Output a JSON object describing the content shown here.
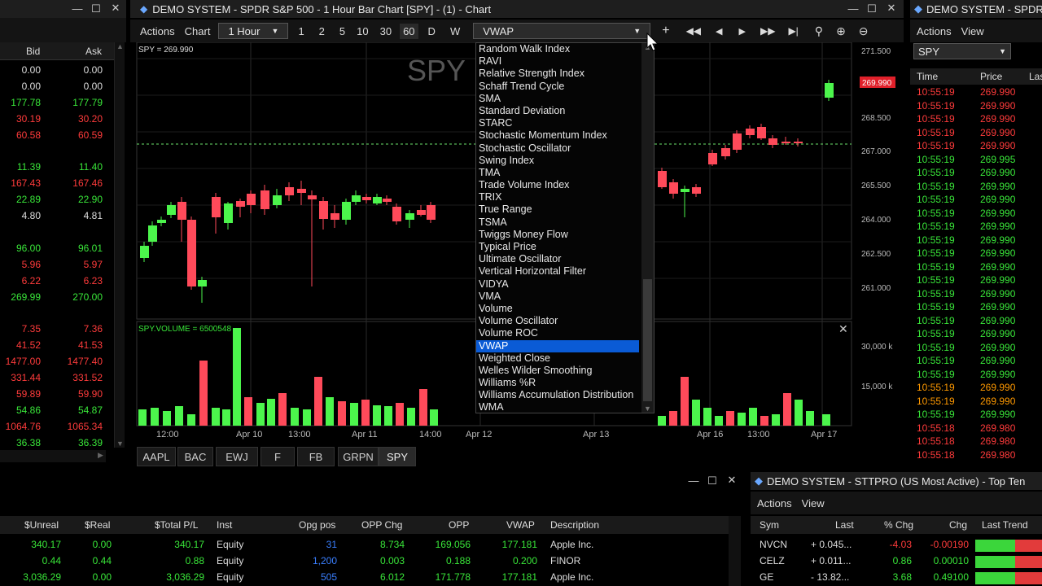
{
  "left_panel": {
    "col_bid": "Bid",
    "col_ask": "Ask",
    "rows": [
      {
        "bid": "0.00",
        "ask": "0.00",
        "c": "wht"
      },
      {
        "bid": "0.00",
        "ask": "0.00",
        "c": "wht"
      },
      {
        "bid": "177.78",
        "ask": "177.79",
        "c": "grn"
      },
      {
        "bid": "30.19",
        "ask": "30.20",
        "c": "red"
      },
      {
        "bid": "60.58",
        "ask": "60.59",
        "c": "red"
      },
      {
        "bid": "",
        "ask": "",
        "c": "wht"
      },
      {
        "bid": "11.39",
        "ask": "11.40",
        "c": "grn"
      },
      {
        "bid": "167.43",
        "ask": "167.46",
        "c": "red"
      },
      {
        "bid": "22.89",
        "ask": "22.90",
        "c": "grn"
      },
      {
        "bid": "4.80",
        "ask": "4.81",
        "c": "wht"
      },
      {
        "bid": "",
        "ask": "",
        "c": "wht"
      },
      {
        "bid": "96.00",
        "ask": "96.01",
        "c": "grn"
      },
      {
        "bid": "5.96",
        "ask": "5.97",
        "c": "red"
      },
      {
        "bid": "6.22",
        "ask": "6.23",
        "c": "red"
      },
      {
        "bid": "269.99",
        "ask": "270.00",
        "c": "grn"
      },
      {
        "bid": "",
        "ask": "",
        "c": "wht"
      },
      {
        "bid": "7.35",
        "ask": "7.36",
        "c": "red"
      },
      {
        "bid": "41.52",
        "ask": "41.53",
        "c": "red"
      },
      {
        "bid": "1477.00",
        "ask": "1477.40",
        "c": "red"
      },
      {
        "bid": "331.44",
        "ask": "331.52",
        "c": "red"
      },
      {
        "bid": "59.89",
        "ask": "59.90",
        "c": "red"
      },
      {
        "bid": "54.86",
        "ask": "54.87",
        "c": "grn"
      },
      {
        "bid": "1064.76",
        "ask": "1065.34",
        "c": "red"
      },
      {
        "bid": "36.38",
        "ask": "36.39",
        "c": "grn"
      }
    ]
  },
  "chart_window": {
    "title": "DEMO SYSTEM - SPDR S&P 500 - 1 Hour Bar Chart [SPY] - (1) - Chart",
    "menu_actions": "Actions",
    "menu_chart": "Chart",
    "interval_value": "1 Hour",
    "interval_buttons": [
      "1",
      "2",
      "5",
      "10",
      "30",
      "60",
      "D",
      "W"
    ],
    "indicator_value": "VWAP",
    "price_label": "SPY = 269.990",
    "watermark": "SPY",
    "volume_label": "SPY.VOLUME = 6500548",
    "price_ticks": [
      "271.500",
      "268.500",
      "267.000",
      "265.500",
      "264.000",
      "262.500",
      "261.000"
    ],
    "last_price_tag": "269.990",
    "volume_ticks": [
      "30,000 k",
      "15,000 k"
    ],
    "time_labels": [
      "12:00",
      "Apr 10",
      "13:00",
      "Apr 11",
      "14:00",
      "Apr 12",
      "Apr 13",
      "Apr 16",
      "13:00",
      "Apr 17"
    ],
    "tabs": [
      "AAPL",
      "BAC",
      "EWJ",
      "F",
      "FB",
      "GRPN",
      "SPY"
    ],
    "active_tab": "SPY"
  },
  "indicator_dropdown": {
    "items": [
      "Random Walk Index",
      "RAVI",
      "Relative Strength Index",
      "Schaff Trend Cycle",
      "SMA",
      "Standard Deviation",
      "STARC",
      "Stochastic Momentum Index",
      "Stochastic Oscillator",
      "Swing Index",
      "TMA",
      "Trade Volume Index",
      "TRIX",
      "True Range",
      "TSMA",
      "Twiggs Money Flow",
      "Typical Price",
      "Ultimate Oscillator",
      "Vertical Horizontal Filter",
      "VIDYA",
      "VMA",
      "Volume",
      "Volume Oscillator",
      "Volume ROC",
      "VWAP",
      "Weighted Close",
      "Welles Wilder Smoothing",
      "Williams %R",
      "Williams Accumulation Distribution",
      "WMA"
    ],
    "selected": "VWAP"
  },
  "timesales_window": {
    "title": "DEMO SYSTEM - SPDR",
    "menu_actions": "Actions",
    "menu_view": "View",
    "symbol": "SPY",
    "col_time": "Time",
    "col_price": "Price",
    "col_last": "Las",
    "rows": [
      {
        "t": "10:55:19",
        "p": "269.990",
        "c": "red"
      },
      {
        "t": "10:55:19",
        "p": "269.990",
        "c": "red"
      },
      {
        "t": "10:55:19",
        "p": "269.990",
        "c": "red"
      },
      {
        "t": "10:55:19",
        "p": "269.990",
        "c": "red"
      },
      {
        "t": "10:55:19",
        "p": "269.990",
        "c": "red"
      },
      {
        "t": "10:55:19",
        "p": "269.995",
        "c": "grn"
      },
      {
        "t": "10:55:19",
        "p": "269.990",
        "c": "grn"
      },
      {
        "t": "10:55:19",
        "p": "269.990",
        "c": "grn"
      },
      {
        "t": "10:55:19",
        "p": "269.990",
        "c": "grn"
      },
      {
        "t": "10:55:19",
        "p": "269.990",
        "c": "grn"
      },
      {
        "t": "10:55:19",
        "p": "269.990",
        "c": "grn"
      },
      {
        "t": "10:55:19",
        "p": "269.990",
        "c": "grn"
      },
      {
        "t": "10:55:19",
        "p": "269.990",
        "c": "grn"
      },
      {
        "t": "10:55:19",
        "p": "269.990",
        "c": "grn"
      },
      {
        "t": "10:55:19",
        "p": "269.990",
        "c": "grn"
      },
      {
        "t": "10:55:19",
        "p": "269.990",
        "c": "grn"
      },
      {
        "t": "10:55:19",
        "p": "269.990",
        "c": "grn"
      },
      {
        "t": "10:55:19",
        "p": "269.990",
        "c": "grn"
      },
      {
        "t": "10:55:19",
        "p": "269.990",
        "c": "grn"
      },
      {
        "t": "10:55:19",
        "p": "269.990",
        "c": "grn"
      },
      {
        "t": "10:55:19",
        "p": "269.990",
        "c": "grn"
      },
      {
        "t": "10:55:19",
        "p": "269.990",
        "c": "grn"
      },
      {
        "t": "10:55:19",
        "p": "269.990",
        "c": "org"
      },
      {
        "t": "10:55:19",
        "p": "269.990",
        "c": "org"
      },
      {
        "t": "10:55:19",
        "p": "269.990",
        "c": "grn"
      },
      {
        "t": "10:55:18",
        "p": "269.980",
        "c": "red"
      },
      {
        "t": "10:55:18",
        "p": "269.980",
        "c": "red"
      },
      {
        "t": "10:55:18",
        "p": "269.980",
        "c": "red"
      }
    ]
  },
  "positions_window": {
    "headers": [
      "$Unreal",
      "$Real",
      "$Total P/L",
      "Inst",
      "Opg pos",
      "OPP Chg",
      "OPP",
      "VWAP",
      "Description"
    ],
    "rows": [
      {
        "unreal": "340.17",
        "real": "0.00",
        "total": "340.17",
        "inst": "Equity",
        "opg": "31",
        "oppchg": "8.734",
        "opp": "169.056",
        "vwap": "177.181",
        "desc": "Apple Inc."
      },
      {
        "unreal": "0.44",
        "real": "0.44",
        "total": "0.88",
        "inst": "Equity",
        "opg": "1,200",
        "oppchg": "0.003",
        "opp": "0.188",
        "vwap": "0.200",
        "desc": "FINOR"
      },
      {
        "unreal": "3,036.29",
        "real": "0.00",
        "total": "3,036.29",
        "inst": "Equity",
        "opg": "505",
        "oppchg": "6.012",
        "opp": "171.778",
        "vwap": "177.181",
        "desc": "Apple Inc."
      }
    ]
  },
  "topten_window": {
    "title": "DEMO SYSTEM - STTPRO (US Most Active) - Top Ten",
    "menu_actions": "Actions",
    "menu_view": "View",
    "headers": [
      "Sym",
      "Last",
      "% Chg",
      "Chg",
      "Last Trend"
    ],
    "rows": [
      {
        "sym": "NVCN",
        "last": "+ 0.045...",
        "pct": "-4.03",
        "chg": "-0.00190",
        "c": "red"
      },
      {
        "sym": "CELZ",
        "last": "+ 0.011...",
        "pct": "0.86",
        "chg": "0.00010",
        "c": "grn"
      },
      {
        "sym": "GE",
        "last": "- 13.82...",
        "pct": "3.68",
        "chg": "0.49100",
        "c": "grn"
      }
    ]
  }
}
